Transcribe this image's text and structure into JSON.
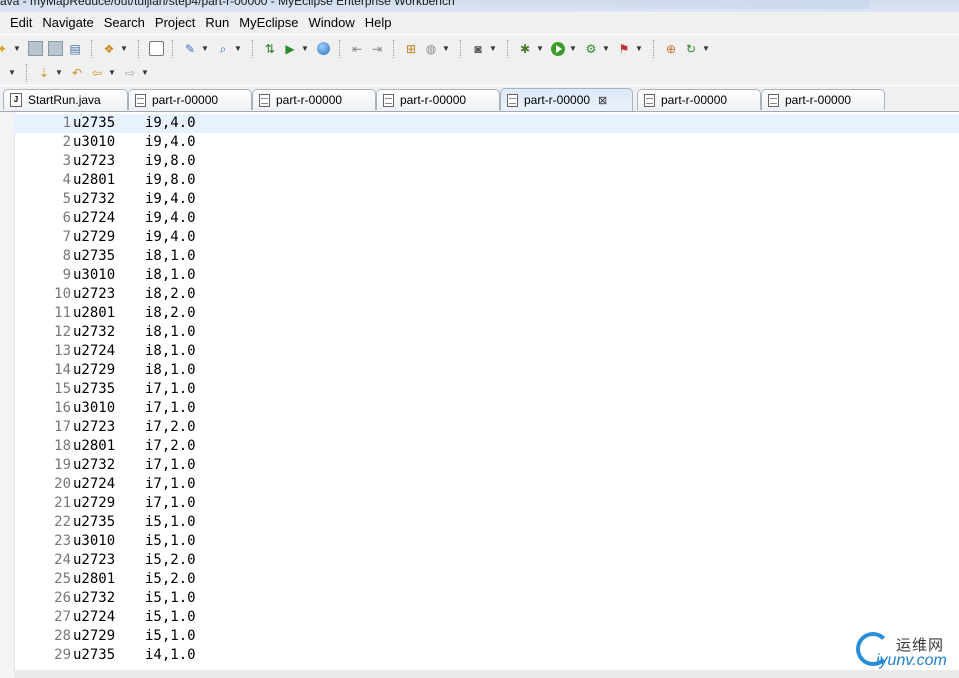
{
  "window": {
    "title": "ava - myMapReduce/out/tuijian/step4/part-r-00000 - MyEclipse Enterprise Workbench"
  },
  "menu": [
    "Edit",
    "Navigate",
    "Search",
    "Project",
    "Run",
    "MyEclipse",
    "Window",
    "Help"
  ],
  "toolbar": {
    "icons_row1": [
      "new-icon",
      "save-icon",
      "save-all-icon",
      "print-icon",
      "new-project-icon",
      "server-icon",
      "open-type-icon",
      "search-icon",
      "deploy-icon",
      "run-server-icon",
      "globe-icon",
      "back-history-icon",
      "forward-history-icon",
      "new-class-icon",
      "browser-icon",
      "camera-icon",
      "debug-icon",
      "run-icon",
      "run-config-icon",
      "external-tools-icon",
      "package-icon",
      "refresh-icon"
    ],
    "icons_row2": [
      "collapse-icon",
      "next-annotation-icon",
      "last-edit-icon",
      "back-icon",
      "forward-icon"
    ]
  },
  "tabs": [
    {
      "label": "StartRun.java",
      "active": false,
      "kind": "java"
    },
    {
      "label": "part-r-00000",
      "active": false,
      "kind": "file"
    },
    {
      "label": "part-r-00000",
      "active": false,
      "kind": "file"
    },
    {
      "label": "part-r-00000",
      "active": false,
      "kind": "file"
    },
    {
      "label": "part-r-00000",
      "active": true,
      "kind": "file"
    },
    {
      "label": "part-r-00000",
      "active": false,
      "kind": "file"
    },
    {
      "label": "part-r-00000",
      "active": false,
      "kind": "file"
    }
  ],
  "editor": {
    "current_line": 1,
    "lines": [
      {
        "n": "1",
        "user": "u2735",
        "value": "i9,4.0"
      },
      {
        "n": "2",
        "user": "u3010",
        "value": "i9,4.0"
      },
      {
        "n": "3",
        "user": "u2723",
        "value": "i9,8.0"
      },
      {
        "n": "4",
        "user": "u2801",
        "value": "i9,8.0"
      },
      {
        "n": "5",
        "user": "u2732",
        "value": "i9,4.0"
      },
      {
        "n": "6",
        "user": "u2724",
        "value": "i9,4.0"
      },
      {
        "n": "7",
        "user": "u2729",
        "value": "i9,4.0"
      },
      {
        "n": "8",
        "user": "u2735",
        "value": "i8,1.0"
      },
      {
        "n": "9",
        "user": "u3010",
        "value": "i8,1.0"
      },
      {
        "n": "10",
        "user": "u2723",
        "value": "i8,2.0"
      },
      {
        "n": "11",
        "user": "u2801",
        "value": "i8,2.0"
      },
      {
        "n": "12",
        "user": "u2732",
        "value": "i8,1.0"
      },
      {
        "n": "13",
        "user": "u2724",
        "value": "i8,1.0"
      },
      {
        "n": "14",
        "user": "u2729",
        "value": "i8,1.0"
      },
      {
        "n": "15",
        "user": "u2735",
        "value": "i7,1.0"
      },
      {
        "n": "16",
        "user": "u3010",
        "value": "i7,1.0"
      },
      {
        "n": "17",
        "user": "u2723",
        "value": "i7,2.0"
      },
      {
        "n": "18",
        "user": "u2801",
        "value": "i7,2.0"
      },
      {
        "n": "19",
        "user": "u2732",
        "value": "i7,1.0"
      },
      {
        "n": "20",
        "user": "u2724",
        "value": "i7,1.0"
      },
      {
        "n": "21",
        "user": "u2729",
        "value": "i7,1.0"
      },
      {
        "n": "22",
        "user": "u2735",
        "value": "i5,1.0"
      },
      {
        "n": "23",
        "user": "u3010",
        "value": "i5,1.0"
      },
      {
        "n": "24",
        "user": "u2723",
        "value": "i5,2.0"
      },
      {
        "n": "25",
        "user": "u2801",
        "value": "i5,2.0"
      },
      {
        "n": "26",
        "user": "u2732",
        "value": "i5,1.0"
      },
      {
        "n": "27",
        "user": "u2724",
        "value": "i5,1.0"
      },
      {
        "n": "28",
        "user": "u2729",
        "value": "i5,1.0"
      },
      {
        "n": "29",
        "user": "u2735",
        "value": "i4,1.0"
      }
    ]
  },
  "watermark": {
    "text_cn": "运维网",
    "domain": "iyunv.com"
  },
  "colors": {
    "accent": "#2a8fd8",
    "current_line": "#e8f2fe",
    "line_number": "#787878"
  }
}
